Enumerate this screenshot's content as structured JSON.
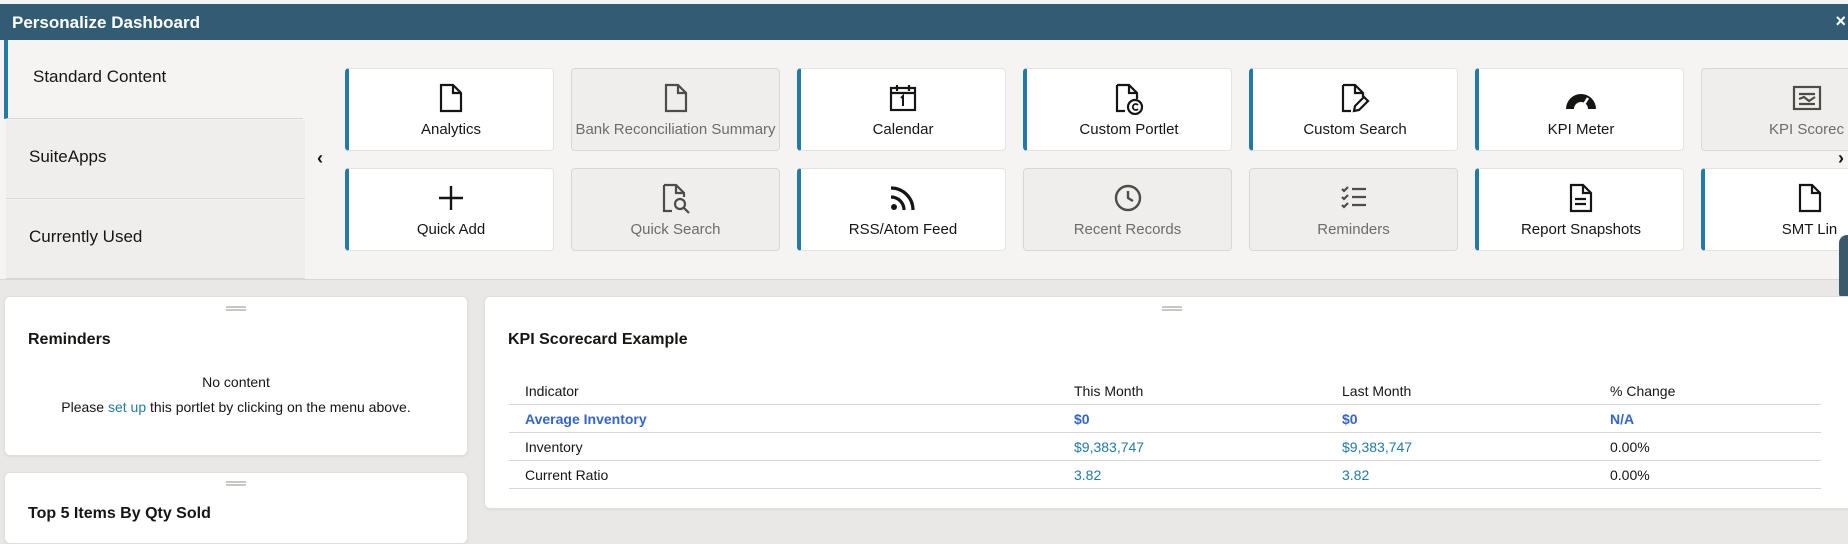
{
  "header": {
    "title": "Personalize Dashboard",
    "close_glyph": "×"
  },
  "tabs": [
    {
      "label": "Standard Content",
      "active": true
    },
    {
      "label": "SuiteApps",
      "active": false
    },
    {
      "label": "Currently Used",
      "active": false
    }
  ],
  "nav": {
    "prev": "‹",
    "next": "›"
  },
  "tiles_row1": [
    {
      "label": "Analytics",
      "icon": "document-icon",
      "state": "available"
    },
    {
      "label": "Bank Reconciliation Summary",
      "icon": "document-icon",
      "state": "disabled"
    },
    {
      "label": "Calendar",
      "icon": "calendar-icon",
      "state": "available"
    },
    {
      "label": "Custom Portlet",
      "icon": "document-copyright-icon",
      "state": "available"
    },
    {
      "label": "Custom Search",
      "icon": "document-edit-icon",
      "state": "available"
    },
    {
      "label": "KPI Meter",
      "icon": "gauge-icon",
      "state": "available"
    },
    {
      "label": "KPI Scorec",
      "icon": "scorecard-icon",
      "state": "disabled"
    }
  ],
  "tiles_row2": [
    {
      "label": "Quick Add",
      "icon": "plus-icon",
      "state": "available"
    },
    {
      "label": "Quick Search",
      "icon": "document-search-icon",
      "state": "disabled"
    },
    {
      "label": "RSS/Atom Feed",
      "icon": "rss-icon",
      "state": "available"
    },
    {
      "label": "Recent Records",
      "icon": "clock-icon",
      "state": "disabled"
    },
    {
      "label": "Reminders",
      "icon": "checklist-icon",
      "state": "disabled"
    },
    {
      "label": "Report Snapshots",
      "icon": "report-icon",
      "state": "available"
    },
    {
      "label": "SMT Lin",
      "icon": "document-icon",
      "state": "available"
    }
  ],
  "reminders": {
    "title": "Reminders",
    "no_content": "No content",
    "prefix": "Please ",
    "link": "set up",
    "suffix": " this portlet by clicking on the menu above."
  },
  "top_items": {
    "title": "Top 5 Items By Qty Sold"
  },
  "kpi": {
    "title": "KPI Scorecard Example",
    "columns": [
      "Indicator",
      "This Month",
      "Last Month",
      "% Change"
    ],
    "rows": [
      {
        "indicator": "Average Inventory",
        "this_month": "$0",
        "last_month": "$0",
        "change": "N/A"
      },
      {
        "indicator": "Inventory",
        "this_month": "$9,383,747",
        "last_month": "$9,383,747",
        "change": "0.00%"
      },
      {
        "indicator": "Current Ratio",
        "this_month": "3.82",
        "last_month": "3.82",
        "change": "0.00%"
      }
    ]
  },
  "colors": {
    "header_bg": "#325c73",
    "accent": "#227aa6",
    "link": "#3366cc"
  }
}
